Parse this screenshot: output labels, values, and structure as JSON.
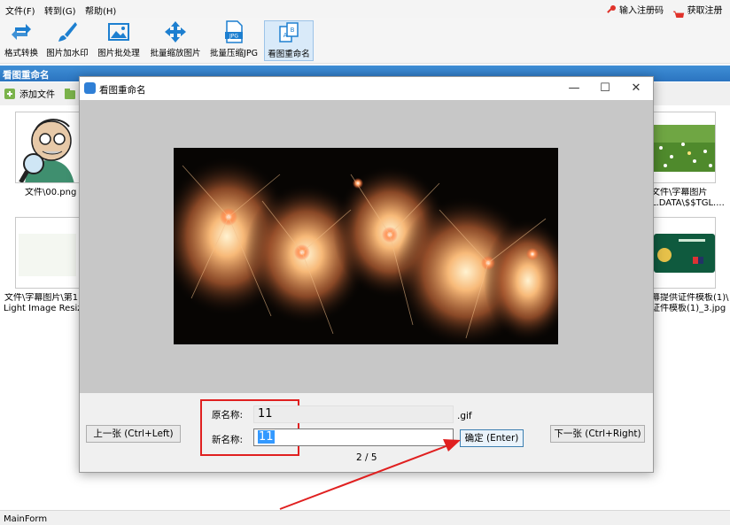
{
  "menu": {
    "file": "文件(F)",
    "goto": "转到(G)",
    "help": "帮助(H)",
    "enter_reg": "输入注册码",
    "get_reg": "获取注册码"
  },
  "toolbar": {
    "format": "格式转换",
    "watermark": "图片加水印",
    "batch_process": "图片批处理",
    "batch_resize": "批量缩放图片",
    "batch_compress": "批量压缩JPG",
    "rename": "看图重命名"
  },
  "section_title": "看图重命名",
  "subtoolbar": {
    "add_file": "添加文件"
  },
  "files": [
    {
      "label": "文件\\00.png"
    },
    {
      "label": "文件\\字幕图片"
    },
    {
      "label": "L.DATA\\$$TGL...."
    },
    {
      "label": "文件\\字幕图片\\第1"
    },
    {
      "label": "Light Image Resize"
    },
    {
      "label": "幕提供证件模板(1)\\"
    },
    {
      "label": "证件模板(1)_3.jpg"
    }
  ],
  "status": "MainForm",
  "dialog": {
    "title": "看图重命名",
    "prev_button": "上一张 (Ctrl+Left)",
    "next_button": "下一张 (Ctrl+Right)",
    "original_label": "原名称:",
    "original_value": "11",
    "new_label": "新名称:",
    "new_value": "11",
    "extension": ".gif",
    "confirm_button": "确定 (Enter)",
    "counter": "2 / 5"
  },
  "colors": {
    "accent": "#2b74c0",
    "highlight": "#e02020",
    "selection": "#3399ff"
  }
}
